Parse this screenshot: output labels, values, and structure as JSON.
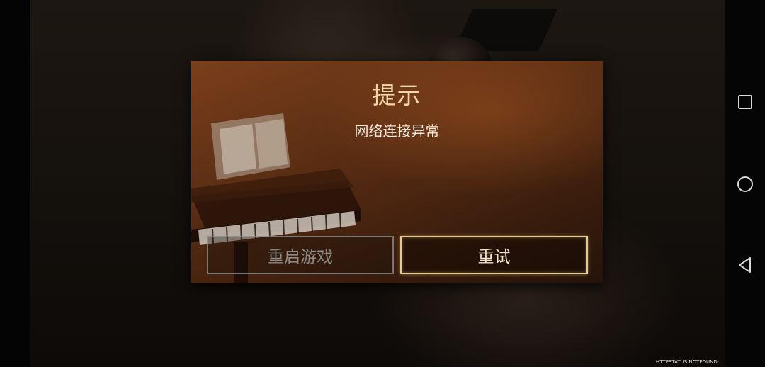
{
  "dialog": {
    "title": "提示",
    "message": "网络连接异常",
    "restart_label": "重启游戏",
    "retry_label": "重试"
  },
  "status": {
    "code": "HTTPSTATUS.NOTFOUND"
  },
  "nav": {
    "icons": [
      "recent-apps-icon",
      "home-icon",
      "back-icon"
    ]
  },
  "colors": {
    "accent_gold": "#e5cc8e",
    "title_color": "#f2d7a8",
    "dialog_brown": "#5a2d13"
  }
}
